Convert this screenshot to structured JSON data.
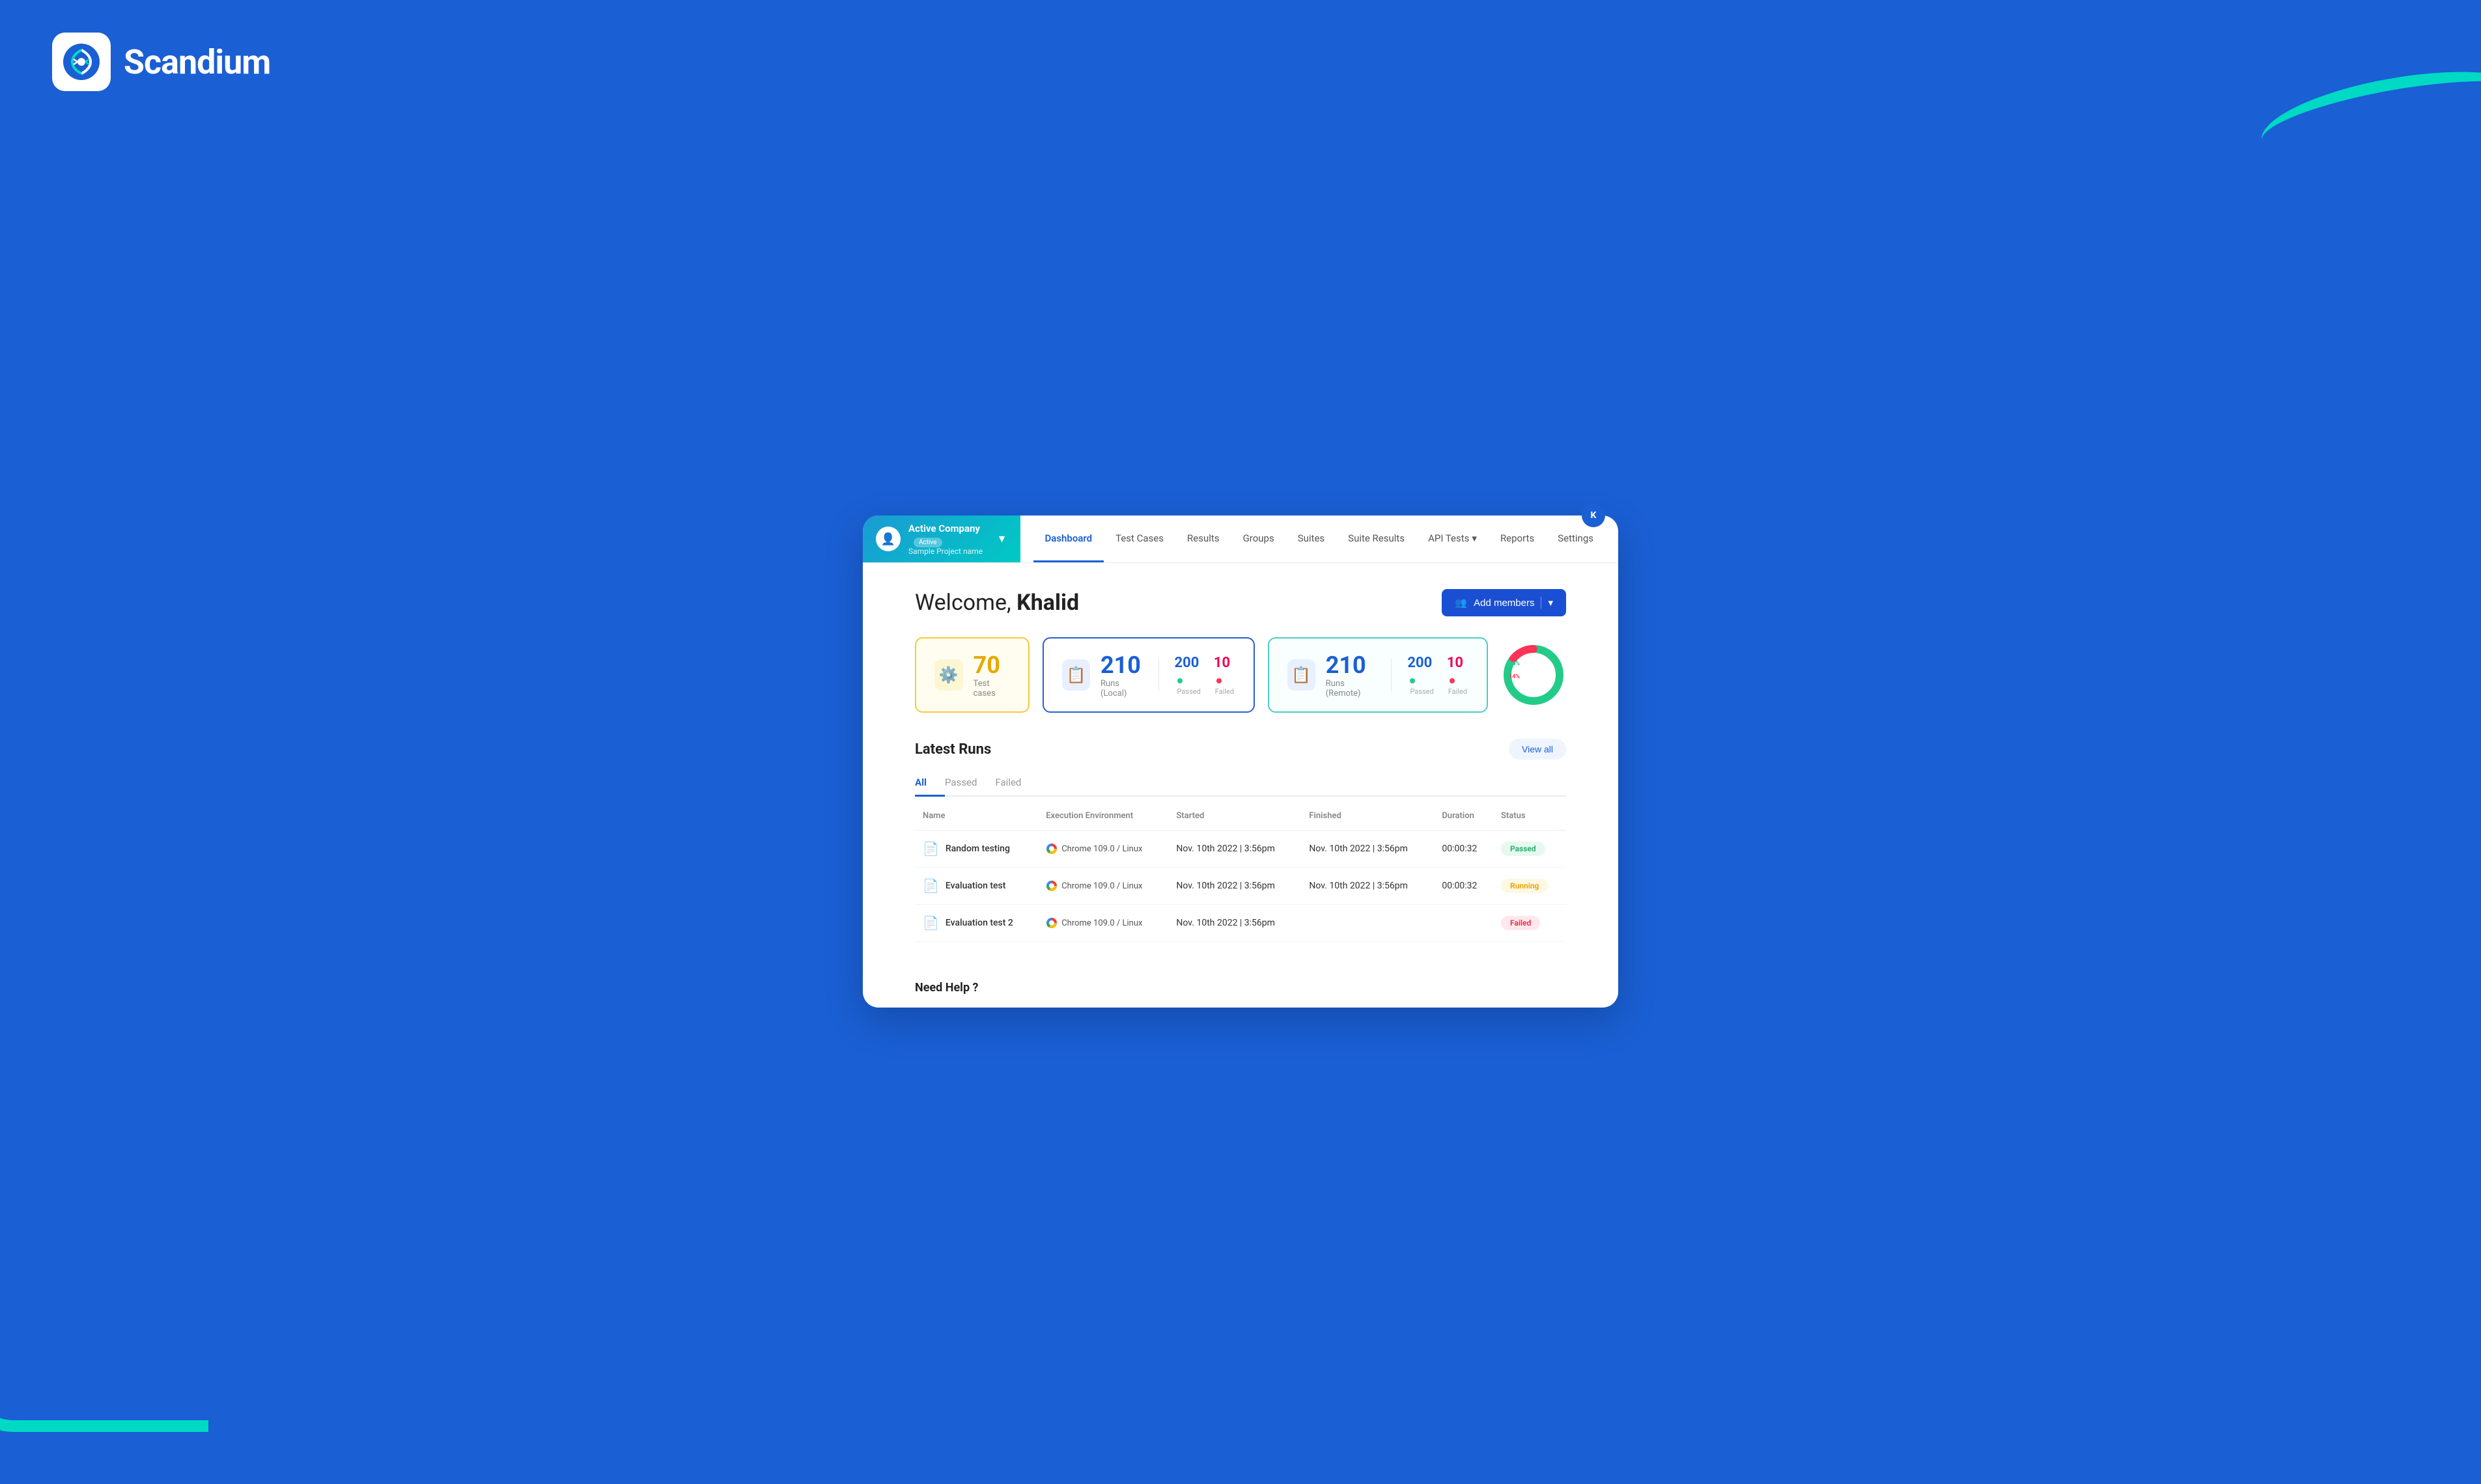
{
  "app": {
    "name": "Scandium"
  },
  "project": {
    "company": "Active Company",
    "badge": "Active",
    "sub": "Sample Project name"
  },
  "nav": {
    "links": [
      {
        "id": "dashboard",
        "label": "Dashboard",
        "active": true
      },
      {
        "id": "test-cases",
        "label": "Test Cases",
        "active": false
      },
      {
        "id": "results",
        "label": "Results",
        "active": false
      },
      {
        "id": "groups",
        "label": "Groups",
        "active": false
      },
      {
        "id": "suites",
        "label": "Suites",
        "active": false
      },
      {
        "id": "suite-results",
        "label": "Suite Results",
        "active": false
      },
      {
        "id": "api-tests",
        "label": "API Tests",
        "active": false,
        "hasDropdown": true
      },
      {
        "id": "reports",
        "label": "Reports",
        "active": false
      },
      {
        "id": "settings",
        "label": "Settings",
        "active": false
      }
    ]
  },
  "welcome": {
    "greeting": "Welcome, ",
    "name": "Khalid"
  },
  "add_members_btn": "Add members",
  "stats": {
    "test_cases": {
      "count": "70",
      "label": "Test cases"
    },
    "local_runs": {
      "count": "210",
      "label": "Runs (Local)",
      "passed": "200",
      "failed": "10"
    },
    "remote_runs": {
      "count": "210",
      "label": "Runs (Remote)",
      "passed": "200",
      "failed": "10"
    },
    "donut": {
      "passed_pct": "86",
      "failed_pct": "14",
      "passed_label": "86%",
      "failed_label": "14%"
    }
  },
  "latest_runs": {
    "title": "Latest Runs",
    "view_all": "View all",
    "tabs": [
      {
        "id": "all",
        "label": "All",
        "active": true
      },
      {
        "id": "passed",
        "label": "Passed",
        "active": false
      },
      {
        "id": "failed",
        "label": "Failed",
        "active": false
      }
    ],
    "columns": [
      "Name",
      "Execution Environment",
      "Started",
      "Finished",
      "Duration",
      "Status"
    ],
    "rows": [
      {
        "name": "Random testing",
        "env": "Chrome 109.0 / Linux",
        "started": "Nov. 10th 2022 | 3:56pm",
        "finished": "Nov. 10th 2022 | 3:56pm",
        "duration": "00:00:32",
        "status": "Passed",
        "status_type": "passed"
      },
      {
        "name": "Evaluation test",
        "env": "Chrome 109.0 / Linux",
        "started": "Nov. 10th 2022 | 3:56pm",
        "finished": "Nov. 10th 2022 | 3:56pm",
        "duration": "00:00:32",
        "status": "Running",
        "status_type": "running"
      },
      {
        "name": "Evaluation test 2",
        "env": "Chrome 109.0 / Linux",
        "started": "Nov. 10th 2022 | 3:56pm",
        "finished": "",
        "duration": "",
        "status": "Failed",
        "status_type": "failed"
      }
    ]
  },
  "need_help": "Need Help ?"
}
